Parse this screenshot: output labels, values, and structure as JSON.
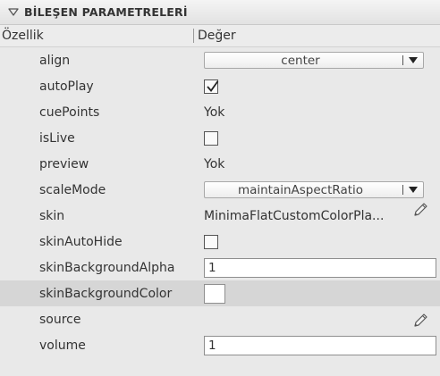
{
  "panel": {
    "title": "BİLEŞEN PARAMETRELERİ",
    "collapse_icon": "triangle-down-icon"
  },
  "columns": {
    "property": "Özellik",
    "value": "Değer"
  },
  "rows": [
    {
      "name": "align",
      "type": "dropdown",
      "value": "center"
    },
    {
      "name": "autoPlay",
      "type": "checkbox",
      "checked": true
    },
    {
      "name": "cuePoints",
      "type": "text",
      "value": "Yok"
    },
    {
      "name": "isLive",
      "type": "checkbox",
      "checked": false
    },
    {
      "name": "preview",
      "type": "text",
      "value": "Yok"
    },
    {
      "name": "scaleMode",
      "type": "dropdown",
      "value": "maintainAspectRatio"
    },
    {
      "name": "skin",
      "type": "text-edit",
      "value": "MinimaFlatCustomColorPla...",
      "icon": "pencil-icon"
    },
    {
      "name": "skinAutoHide",
      "type": "checkbox",
      "checked": false
    },
    {
      "name": "skinBackgroundAlpha",
      "type": "input",
      "value": "1"
    },
    {
      "name": "skinBackgroundColor",
      "type": "color",
      "value": "#ffffff",
      "selected": true
    },
    {
      "name": "source",
      "type": "edit",
      "value": "",
      "icon": "pencil-icon"
    },
    {
      "name": "volume",
      "type": "input",
      "value": "1"
    }
  ]
}
